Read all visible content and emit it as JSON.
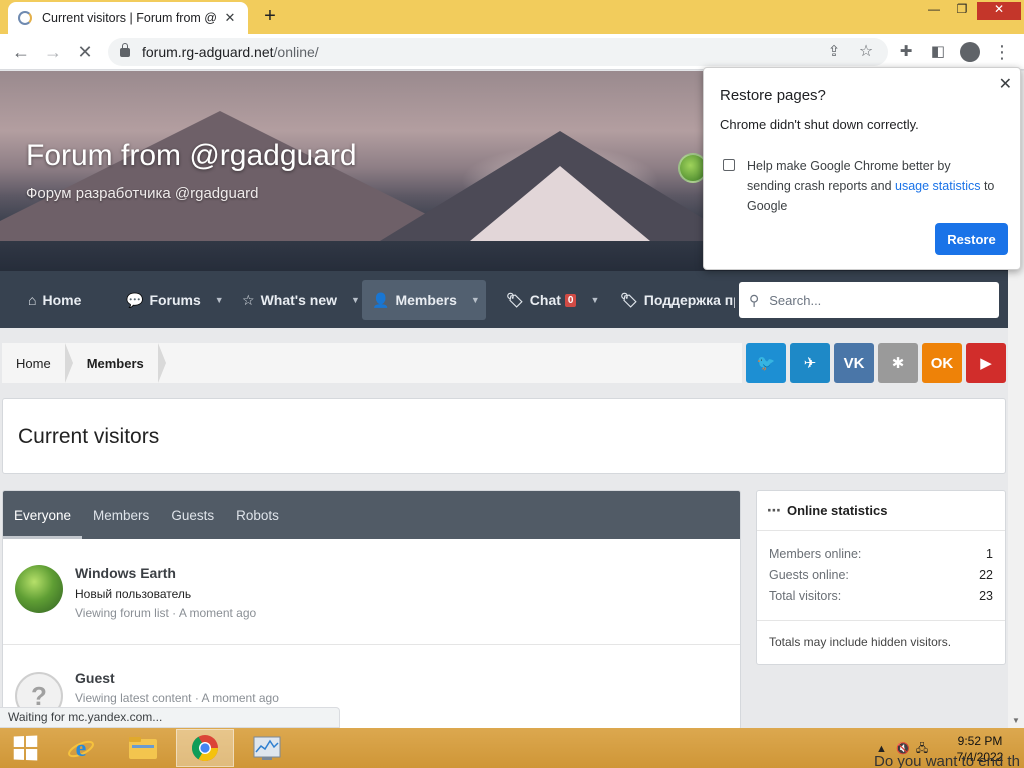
{
  "browser": {
    "tab_title": "Current visitors | Forum from @rgadguard",
    "tab_close": "✕",
    "new_tab": "+",
    "url_host": "forum.rg-adguard.net",
    "url_path": "/online/",
    "window_controls": {
      "minimize": "—",
      "restore": "❐",
      "close": "✕"
    },
    "status_text": "Waiting for mc.yandex.com..."
  },
  "header": {
    "title": "Forum from @rgadguard",
    "subtitle": "Форум разработчика @rgadguard"
  },
  "nav": {
    "items": [
      {
        "label": "Home",
        "icon": "home-icon"
      },
      {
        "label": "Forums",
        "icon": "chat-bubbles-icon"
      },
      {
        "label": "What's new",
        "icon": "star-icon"
      },
      {
        "label": "Members",
        "icon": "user-icon"
      },
      {
        "label": "Chat",
        "icon": "tag-icon",
        "badge": "0"
      },
      {
        "label": "Поддержка пр",
        "icon": "tag-icon"
      }
    ],
    "search_placeholder": "Search..."
  },
  "breadcrumb": [
    "Home",
    "Members"
  ],
  "social": [
    {
      "name": "twitter",
      "glyph": "🐦",
      "color": "#1d8fd3"
    },
    {
      "name": "telegram",
      "glyph": "✈",
      "color": "#1e89c7"
    },
    {
      "name": "vk",
      "glyph": "VK",
      "color": "#4a76a8"
    },
    {
      "name": "other",
      "glyph": "✱",
      "color": "#9a9a9a"
    },
    {
      "name": "odnoklassniki",
      "glyph": "OK",
      "color": "#ee8208"
    },
    {
      "name": "youtube",
      "glyph": "▶",
      "color": "#d12d2b"
    }
  ],
  "page_title": "Current visitors",
  "tabs": [
    "Everyone",
    "Members",
    "Guests",
    "Robots"
  ],
  "members": [
    {
      "name": "Windows Earth",
      "role": "Новый пользователь",
      "activity": "Viewing forum list · A moment ago"
    },
    {
      "name": "Guest",
      "role": "",
      "activity": "Viewing latest content · A moment ago"
    }
  ],
  "online_stats": {
    "title": "Online statistics",
    "rows": [
      {
        "label": "Members online:",
        "value": "1"
      },
      {
        "label": "Guests online:",
        "value": "22"
      },
      {
        "label": "Total visitors:",
        "value": "23"
      }
    ],
    "footnote": "Totals may include hidden visitors."
  },
  "restore_popup": {
    "title": "Restore pages?",
    "message": "Chrome didn't shut down correctly.",
    "checkbox_text_1": "Help make Google Chrome better by sending crash reports and ",
    "checkbox_link": "usage statistics",
    "checkbox_text_2": " to Google",
    "button": "Restore"
  },
  "taskbar": {
    "time": "9:52 PM",
    "date": "7/4/2022",
    "toast_peek": "Do you want to end th"
  }
}
